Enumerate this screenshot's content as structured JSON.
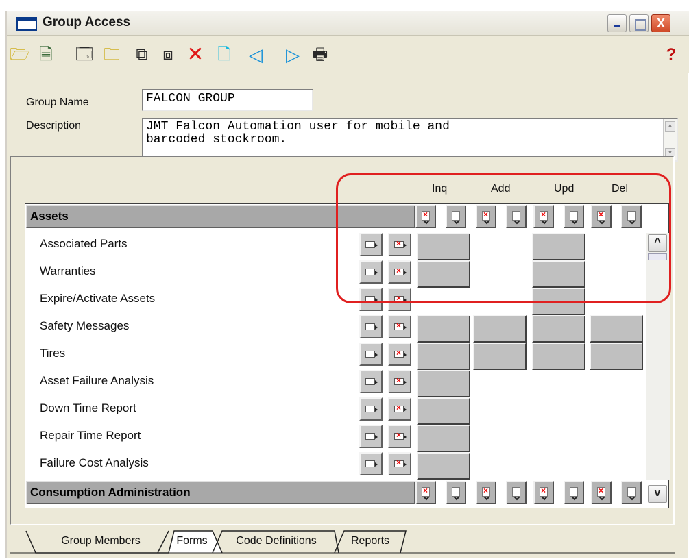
{
  "window": {
    "title": "Group Access",
    "close_label": "X"
  },
  "toolbar": {
    "icons": [
      "open-folder-icon",
      "new-record-icon",
      "form-icon",
      "folder-doc-icon",
      "copy-records-icon",
      "paste-records-icon",
      "delete-icon",
      "new-icon",
      "previous-icon",
      "next-icon",
      "print-icon",
      "help-icon"
    ],
    "glyphs": {
      "open_folder": "🗁",
      "new_record": "🗎",
      "form": "🗔",
      "folder_doc": "🗀",
      "copy_records": "⧉",
      "paste_records": "⧈",
      "delete": "✕",
      "new": "🗋",
      "previous": "◁",
      "next": "▷",
      "print": "🖶",
      "help": "?"
    }
  },
  "form": {
    "group_name_label": "Group Name",
    "group_name_value": "FALCON GROUP",
    "description_label": "Description",
    "description_value": "JMT Falcon Automation user for mobile and\nbarcoded stockroom.",
    "scroll_up": "▲",
    "scroll_down": "▼"
  },
  "permissions": {
    "columns": [
      "Inq",
      "Add",
      "Upd",
      "Del"
    ],
    "sections": [
      {
        "name": "Assets",
        "rows": [
          {
            "label": "Associated Parts",
            "perms": [
              true,
              false,
              true,
              false
            ]
          },
          {
            "label": "Warranties",
            "perms": [
              true,
              false,
              true,
              false
            ]
          },
          {
            "label": "Expire/Activate Assets",
            "perms": [
              false,
              false,
              true,
              false
            ]
          },
          {
            "label": "Safety Messages",
            "perms": [
              true,
              true,
              true,
              true
            ]
          },
          {
            "label": "Tires",
            "perms": [
              true,
              true,
              true,
              true
            ]
          },
          {
            "label": "Asset Failure Analysis",
            "perms": [
              true,
              false,
              false,
              false
            ]
          },
          {
            "label": "Down Time Report",
            "perms": [
              true,
              false,
              false,
              false
            ]
          },
          {
            "label": "Repair Time Report",
            "perms": [
              true,
              false,
              false,
              false
            ]
          },
          {
            "label": "Failure Cost Analysis",
            "perms": [
              true,
              false,
              false,
              false
            ]
          }
        ]
      },
      {
        "name": "Consumption Administration",
        "rows": []
      }
    ],
    "scroll_up": "^",
    "scroll_down": "v"
  },
  "tabs": [
    {
      "label": "Group Members",
      "active": false
    },
    {
      "label": "Forms",
      "active": true
    },
    {
      "label": "Code Definitions",
      "active": false
    },
    {
      "label": "Reports",
      "active": false
    }
  ],
  "colors": {
    "highlight": "#e02020",
    "window_bg": "#ece9d8",
    "section_bg": "#a8a8a8"
  }
}
